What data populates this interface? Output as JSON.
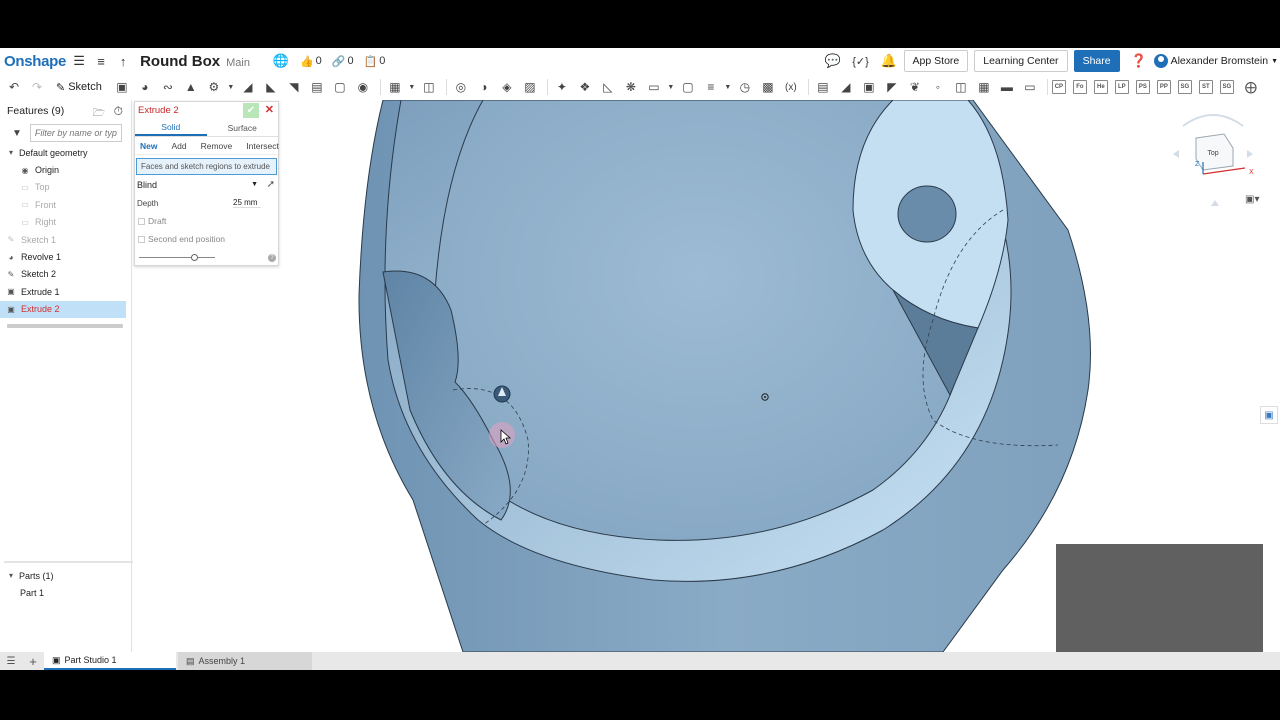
{
  "header": {
    "logo": "Onshape",
    "doc_title": "Round Box",
    "branch": "Main",
    "likes": "0",
    "links": "0",
    "copies": "0",
    "app_store": "App Store",
    "learning_center": "Learning Center",
    "share": "Share",
    "user": "Alexander Bromstein"
  },
  "toolbar": {
    "sketch": "Sketch",
    "small_tools": [
      "CP",
      "Fo",
      "He",
      "LP",
      "PS",
      "PP",
      "SG",
      "ST",
      "SG"
    ]
  },
  "features": {
    "title": "Features (9)",
    "filter_placeholder": "Filter by name or type",
    "default_geometry": "Default geometry",
    "items": [
      "Origin",
      "Top",
      "Front",
      "Right",
      "Sketch 1",
      "Revolve 1",
      "Sketch 2",
      "Extrude 1",
      "Extrude 2"
    ]
  },
  "parts": {
    "title": "Parts (1)",
    "item": "Part 1"
  },
  "dialog": {
    "title": "Extrude 2",
    "tab_solid": "Solid",
    "tab_surface": "Surface",
    "op_new": "New",
    "op_add": "Add",
    "op_remove": "Remove",
    "op_intersect": "Intersect",
    "selection": "Faces and sketch regions to extrude",
    "end_type": "Blind",
    "depth_label": "Depth",
    "depth_value": "25 mm",
    "draft": "Draft",
    "second_end": "Second end position"
  },
  "viewcube": {
    "face": "Top",
    "axis_x": "X",
    "axis_z": "Z"
  },
  "tabs": {
    "part_studio": "Part Studio 1",
    "assembly": "Assembly 1"
  },
  "colors": {
    "accent": "#1f6fb8",
    "model": "#8fb0cc",
    "selected_row": "#bfe0f7",
    "error_red": "#c62828"
  }
}
